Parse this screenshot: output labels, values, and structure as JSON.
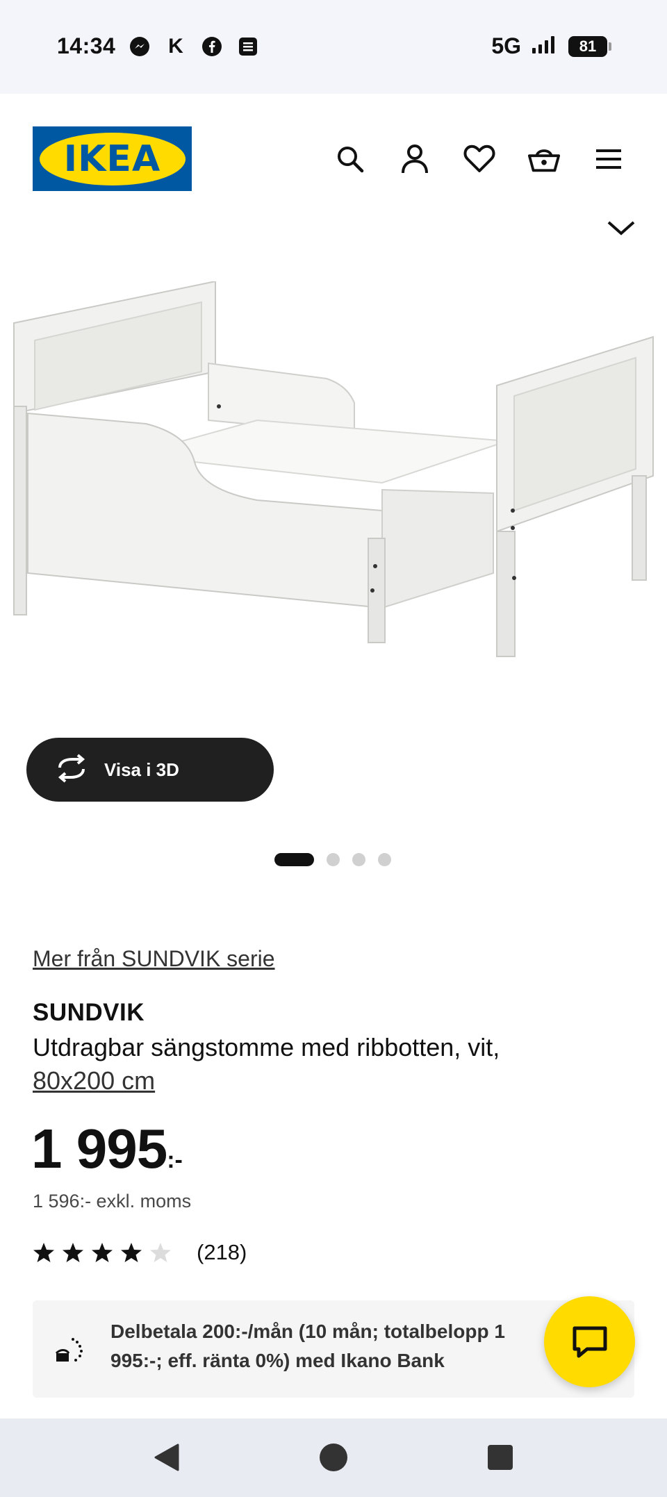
{
  "status_bar": {
    "time": "14:34",
    "app_icons": [
      "messenger-icon",
      "k-icon",
      "facebook-icon",
      "news-icon"
    ],
    "k_label": "K",
    "network": "5G",
    "battery": "81"
  },
  "header": {
    "logo_text": "IKEA",
    "icons": [
      "search-icon",
      "user-icon",
      "heart-icon",
      "basket-icon",
      "menu-icon"
    ]
  },
  "gallery": {
    "view_3d_label": "Visa i 3D",
    "dot_count": 4,
    "active_dot": 0
  },
  "product": {
    "series_link": "Mer från SUNDVIK serie",
    "name": "SUNDVIK",
    "description": "Utdragbar sängstomme med ribbotten, vit,",
    "size": "80x200 cm",
    "price_main": "1 995",
    "price_suffix": ":-",
    "price_ex_vat": "1 596:- exkl. moms",
    "rating": 4,
    "rating_max": 5,
    "review_count": "(218)"
  },
  "financing": {
    "text": "Delbetala 200:-/mån (10 mån; totalbelopp 1 995:-; eff. ränta 0%) med Ikano Bank"
  },
  "colors": {
    "ikea_blue": "#0058a3",
    "ikea_yellow": "#ffdb00"
  },
  "navbar": {
    "icons": [
      "back-icon",
      "home-icon",
      "recents-icon"
    ]
  }
}
